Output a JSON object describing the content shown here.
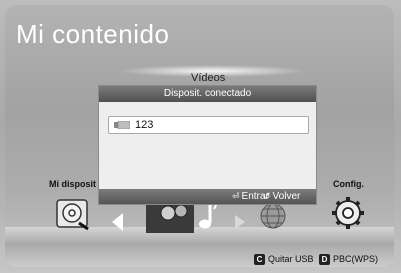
{
  "page": {
    "title": "Mi contenido"
  },
  "menu": {
    "items": [
      {
        "label": "Mi disposit",
        "icon": "disc-icon"
      },
      {
        "label": "Vídeos"
      },
      {
        "label": "Config.",
        "icon": "gear-icon"
      }
    ],
    "other_icons": [
      "box-icon",
      "music-icon",
      "globe-icon",
      "arrow-left-icon",
      "arrow-right-icon"
    ]
  },
  "dialog": {
    "title": "Disposit. conectado",
    "device": {
      "name": "123",
      "icon": "usb-drive-icon"
    },
    "buttons": [
      {
        "label": "Entrar",
        "glyph": "⏎"
      },
      {
        "label": "Volver",
        "glyph": "↺"
      }
    ]
  },
  "bottom_bar": [
    {
      "key": "C",
      "label": "Quitar USB"
    },
    {
      "key": "D",
      "label": "PBC(WPS)"
    }
  ]
}
